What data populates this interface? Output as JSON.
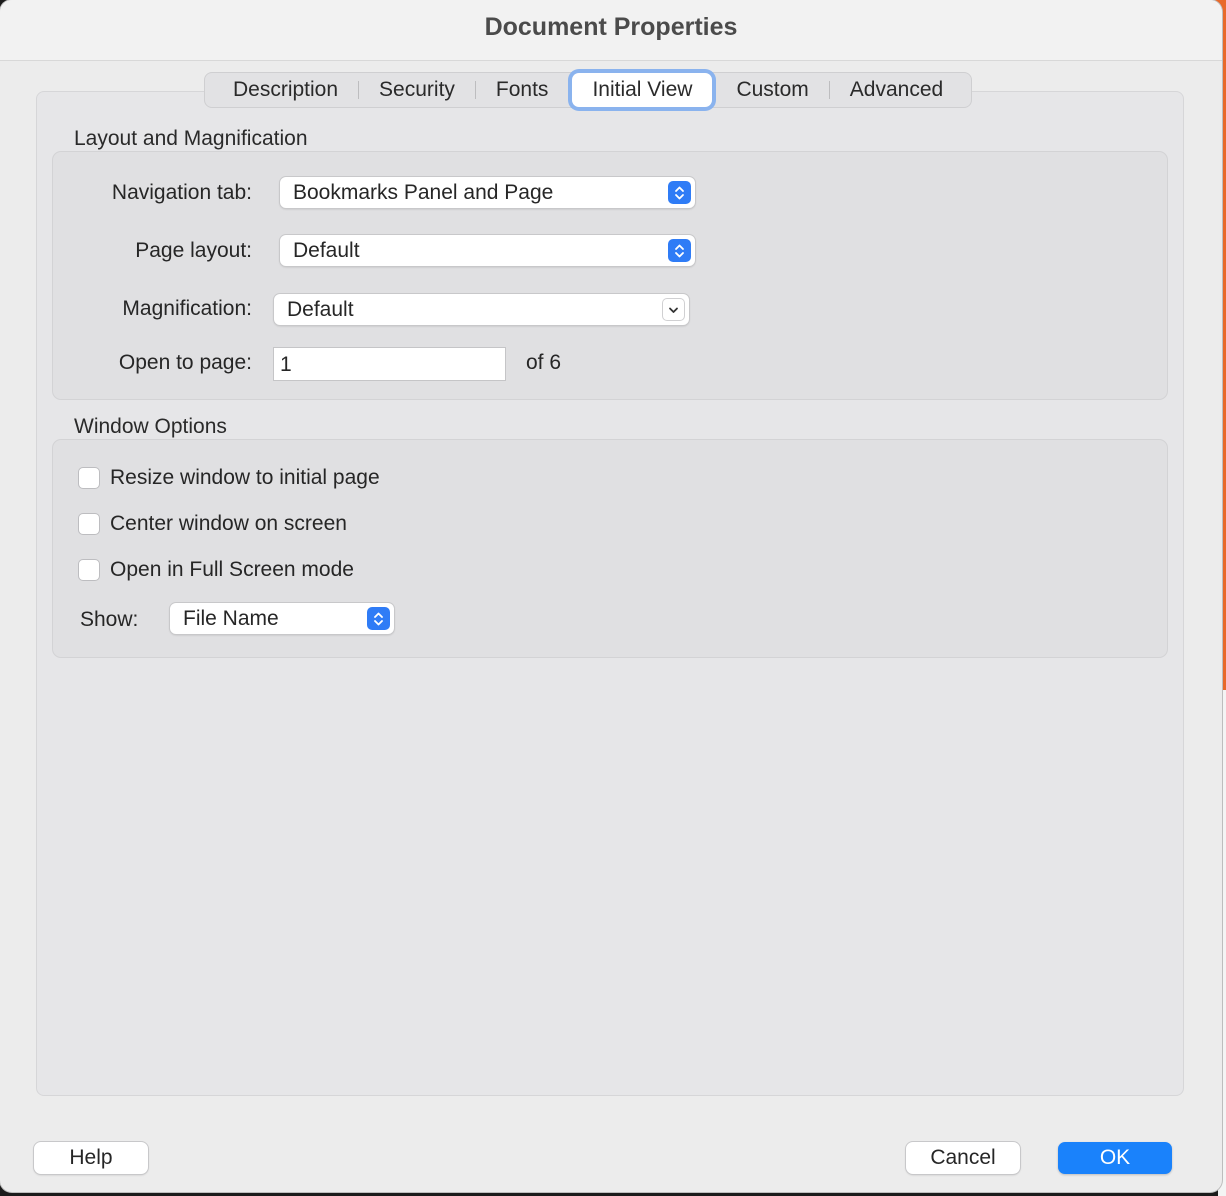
{
  "dialog": {
    "title": "Document Properties"
  },
  "tabs": [
    {
      "label": "Description",
      "active": false
    },
    {
      "label": "Security",
      "active": false
    },
    {
      "label": "Fonts",
      "active": false
    },
    {
      "label": "Initial View",
      "active": true
    },
    {
      "label": "Custom",
      "active": false
    },
    {
      "label": "Advanced",
      "active": false
    }
  ],
  "layout_section": {
    "title": "Layout and Magnification",
    "navigation_tab": {
      "label": "Navigation tab:",
      "value": "Bookmarks Panel and Page"
    },
    "page_layout": {
      "label": "Page layout:",
      "value": "Default"
    },
    "magnification": {
      "label": "Magnification:",
      "value": "Default"
    },
    "open_to_page": {
      "label": "Open to page:",
      "value": "1",
      "of_text": "of 6"
    }
  },
  "window_section": {
    "title": "Window Options",
    "checkboxes": [
      {
        "label": "Resize window to initial page",
        "checked": false
      },
      {
        "label": "Center window on screen",
        "checked": false
      },
      {
        "label": "Open in Full Screen mode",
        "checked": false
      }
    ],
    "show": {
      "label": "Show:",
      "value": "File Name"
    }
  },
  "buttons": {
    "help": "Help",
    "cancel": "Cancel",
    "ok": "OK"
  },
  "colors": {
    "accent": "#1a82fb",
    "focus_ring": "#8ab3ee",
    "background": "#ececec"
  }
}
